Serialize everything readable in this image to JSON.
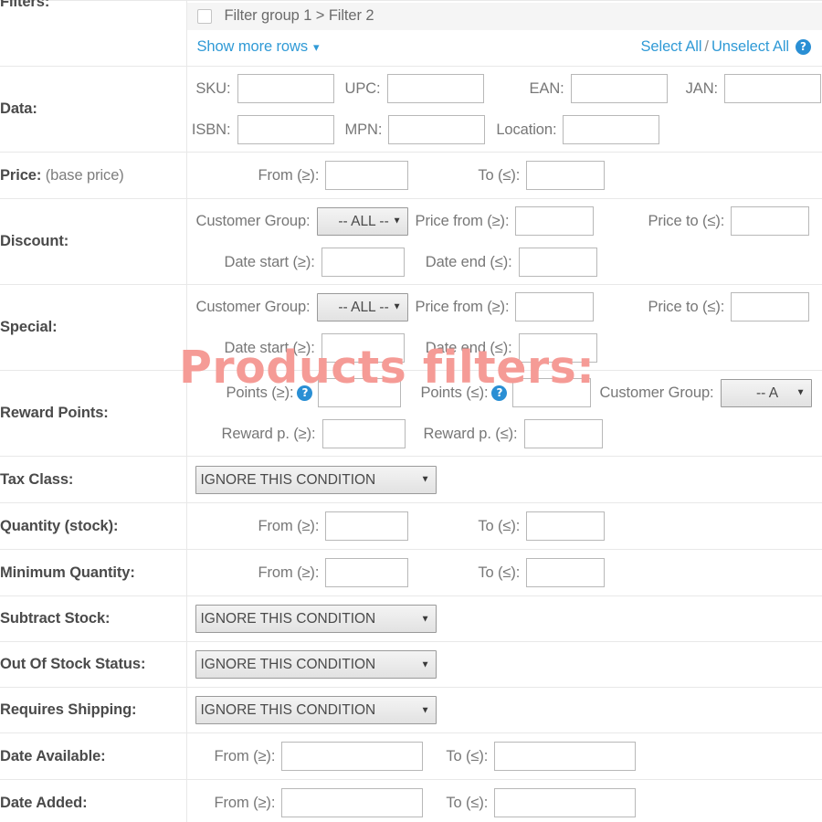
{
  "watermark": {
    "text": "Products filters:"
  },
  "rows": {
    "filters": {
      "label": "Filters:",
      "group_item": "Filter group 1 > Filter 2",
      "show_more": "Show more rows",
      "chevron_icon": "chevron-down-icon",
      "select_all": "Select All",
      "separator": "/",
      "unselect_all": "Unselect All",
      "help_icon": "?"
    },
    "data": {
      "label": "Data:",
      "fields": [
        {
          "label": "SKU:",
          "value": ""
        },
        {
          "label": "UPC:",
          "value": ""
        },
        {
          "label": "EAN:",
          "value": ""
        },
        {
          "label": "JAN:",
          "value": ""
        },
        {
          "label": "ISBN:",
          "value": ""
        },
        {
          "label": "MPN:",
          "value": ""
        },
        {
          "label": "Location:",
          "value": ""
        }
      ]
    },
    "price": {
      "label": "Price:",
      "sub_label": "(base price)",
      "from_label": "From (≥):",
      "from_value": "",
      "to_label": "To (≤):",
      "to_value": ""
    },
    "discount": {
      "label": "Discount:",
      "customer_group_label": "Customer Group:",
      "customer_group_value": "-- ALL --",
      "price_from_label": "Price from (≥):",
      "price_from_value": "",
      "price_to_label": "Price to (≤):",
      "price_to_value": "",
      "date_start_label": "Date start (≥):",
      "date_start_value": "",
      "date_end_label": "Date end (≤):",
      "date_end_value": ""
    },
    "special": {
      "label": "Special:",
      "customer_group_label": "Customer Group:",
      "customer_group_value": "-- ALL --",
      "price_from_label": "Price from (≥):",
      "price_from_value": "",
      "price_to_label": "Price to (≤):",
      "price_to_value": "",
      "date_start_label": "Date start (≥):",
      "date_start_value": "",
      "date_end_label": "Date end (≤):",
      "date_end_value": ""
    },
    "reward_points": {
      "label": "Reward Points:",
      "points_min_label": "Points (≥):",
      "points_min_value": "",
      "points_max_label": "Points (≤):",
      "points_max_value": "",
      "customer_group_label": "Customer Group:",
      "customer_group_value": "-- A",
      "reward_min_label": "Reward p. (≥):",
      "reward_min_value": "",
      "reward_max_label": "Reward p. (≤):",
      "reward_max_value": "",
      "help_icon": "?"
    },
    "tax_class": {
      "label": "Tax Class:",
      "value": "IGNORE THIS CONDITION"
    },
    "quantity_stock": {
      "label": "Quantity (stock):",
      "from_label": "From (≥):",
      "from_value": "",
      "to_label": "To (≤):",
      "to_value": ""
    },
    "minimum_quantity": {
      "label": "Minimum Quantity:",
      "from_label": "From (≥):",
      "from_value": "",
      "to_label": "To (≤):",
      "to_value": ""
    },
    "subtract_stock": {
      "label": "Subtract Stock:",
      "value": "IGNORE THIS CONDITION"
    },
    "out_of_stock_status": {
      "label": "Out Of Stock Status:",
      "value": "IGNORE THIS CONDITION"
    },
    "requires_shipping": {
      "label": "Requires Shipping:",
      "value": "IGNORE THIS CONDITION"
    },
    "date_available": {
      "label": "Date Available:",
      "from_label": "From (≥):",
      "from_value": "",
      "to_label": "To (≤):",
      "to_value": ""
    },
    "date_added": {
      "label": "Date Added:",
      "from_label": "From (≥):",
      "from_value": "",
      "to_label": "To (≤):",
      "to_value": ""
    }
  },
  "colors": {
    "link": "#309ad6",
    "label": "#4a4a4a",
    "field_label": "#777777",
    "watermark": "#f59b96",
    "border": "#e8e8e8",
    "help_badge": "#2a8fd4"
  }
}
